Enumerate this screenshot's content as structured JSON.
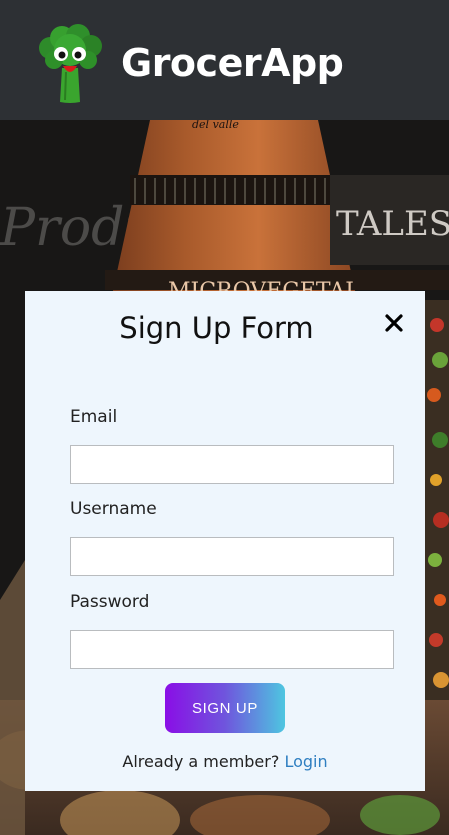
{
  "header": {
    "app_title": "GrocerApp",
    "logo_icon": "broccoli-mascot-icon"
  },
  "background": {
    "signage_text_1": "MICROVEGETAL",
    "signage_text_2": "TALES V",
    "signage_text_3": "Produ",
    "signage_text_4": "del valle"
  },
  "modal": {
    "title": "Sign Up Form",
    "close_icon": "close-icon",
    "fields": [
      {
        "label": "Email",
        "value": "",
        "placeholder": ""
      },
      {
        "label": "Username",
        "value": "",
        "placeholder": ""
      },
      {
        "label": "Password",
        "value": "",
        "placeholder": ""
      }
    ],
    "submit_label": "SIGN UP",
    "member_prompt": "Already a member?",
    "login_label": "Login"
  },
  "colors": {
    "header_bg": "#2d3034",
    "modal_bg": "#eef6fd",
    "button_gradient_start": "#8a0ee6",
    "button_gradient_end": "#4ec6e0",
    "link": "#2f7fc1"
  }
}
